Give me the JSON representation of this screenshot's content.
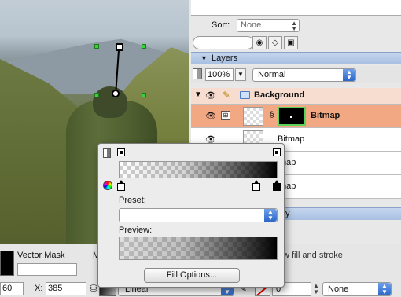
{
  "canvas": {},
  "panel": {
    "sort": {
      "label": "Sort:",
      "value": "None"
    },
    "layers": {
      "title": "Layers",
      "opacity": "100%",
      "blend_mode": "Normal",
      "rows": [
        {
          "name": "Background"
        },
        {
          "name": "Bitmap"
        },
        {
          "name": "Bitmap"
        },
        {
          "name": "map"
        },
        {
          "name": "map"
        }
      ]
    },
    "footer_fragment": "y"
  },
  "inspector": {
    "vector_mask_label": "Vector Mask",
    "m_label": "M",
    "fill_stroke_text": "w fill and stroke",
    "x_value_left": "60",
    "x_label": "X:",
    "x_value": "385",
    "fill_type": "Linear",
    "stroke_width": "0",
    "stroke_style": "None"
  },
  "popup": {
    "preset_label": "Preset:",
    "preset_value": "",
    "preview_label": "Preview:",
    "fill_options_button": "Fill Options..."
  },
  "icons": {
    "eye": "eye-icon",
    "pencil": "pencil-icon",
    "folder": "folder-icon",
    "chain": "link-icon",
    "color_wheel": "color-wheel-icon",
    "bucket": "paint-bucket-icon"
  }
}
